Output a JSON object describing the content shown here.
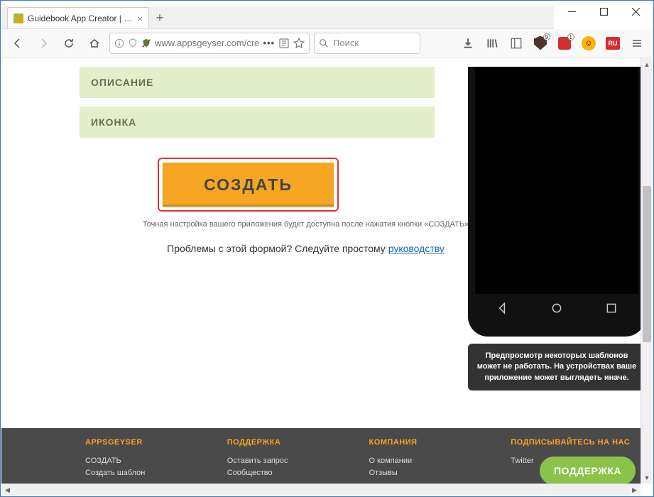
{
  "window": {
    "tab_title": "Guidebook App Creator | Creat…"
  },
  "nav": {
    "url_display": "www.appsgeyser.com/cre",
    "search_placeholder": "Поиск",
    "ext_badge_1": "9",
    "ext_badge_2": "1",
    "ext_ru": "RU"
  },
  "sections": {
    "description": "ОПИСАНИЕ",
    "icon": "ИКОНКА"
  },
  "create": {
    "label": "СОЗДАТЬ",
    "note": "Точная настройка вашего приложения будет доступна после нажатия кнопки «СОЗДАТЬ»"
  },
  "help": {
    "prefix": "Проблемы с этой формой? Следуйте простому ",
    "link": "руководству"
  },
  "preview_note": "Предпросмотр некоторых шаблонов может не работать. На устройствах ваше приложение может выглядеть иначе.",
  "footer": {
    "col1": {
      "title": "APPSGEYSER",
      "l1": "СОЗДАТЬ",
      "l2": "Создать шаблон"
    },
    "col2": {
      "title": "ПОДДЕРЖКА",
      "l1": "Оставить запрос",
      "l2": "Сообщество"
    },
    "col3": {
      "title": "КОМПАНИЯ",
      "l1": "О компании",
      "l2": "Отзывы"
    },
    "col4": {
      "title": "ПОДПИСЫВАЙТЕСЬ НА НАС",
      "l1": "Twitter"
    }
  },
  "support_btn": "ПОДДЕРЖКА"
}
